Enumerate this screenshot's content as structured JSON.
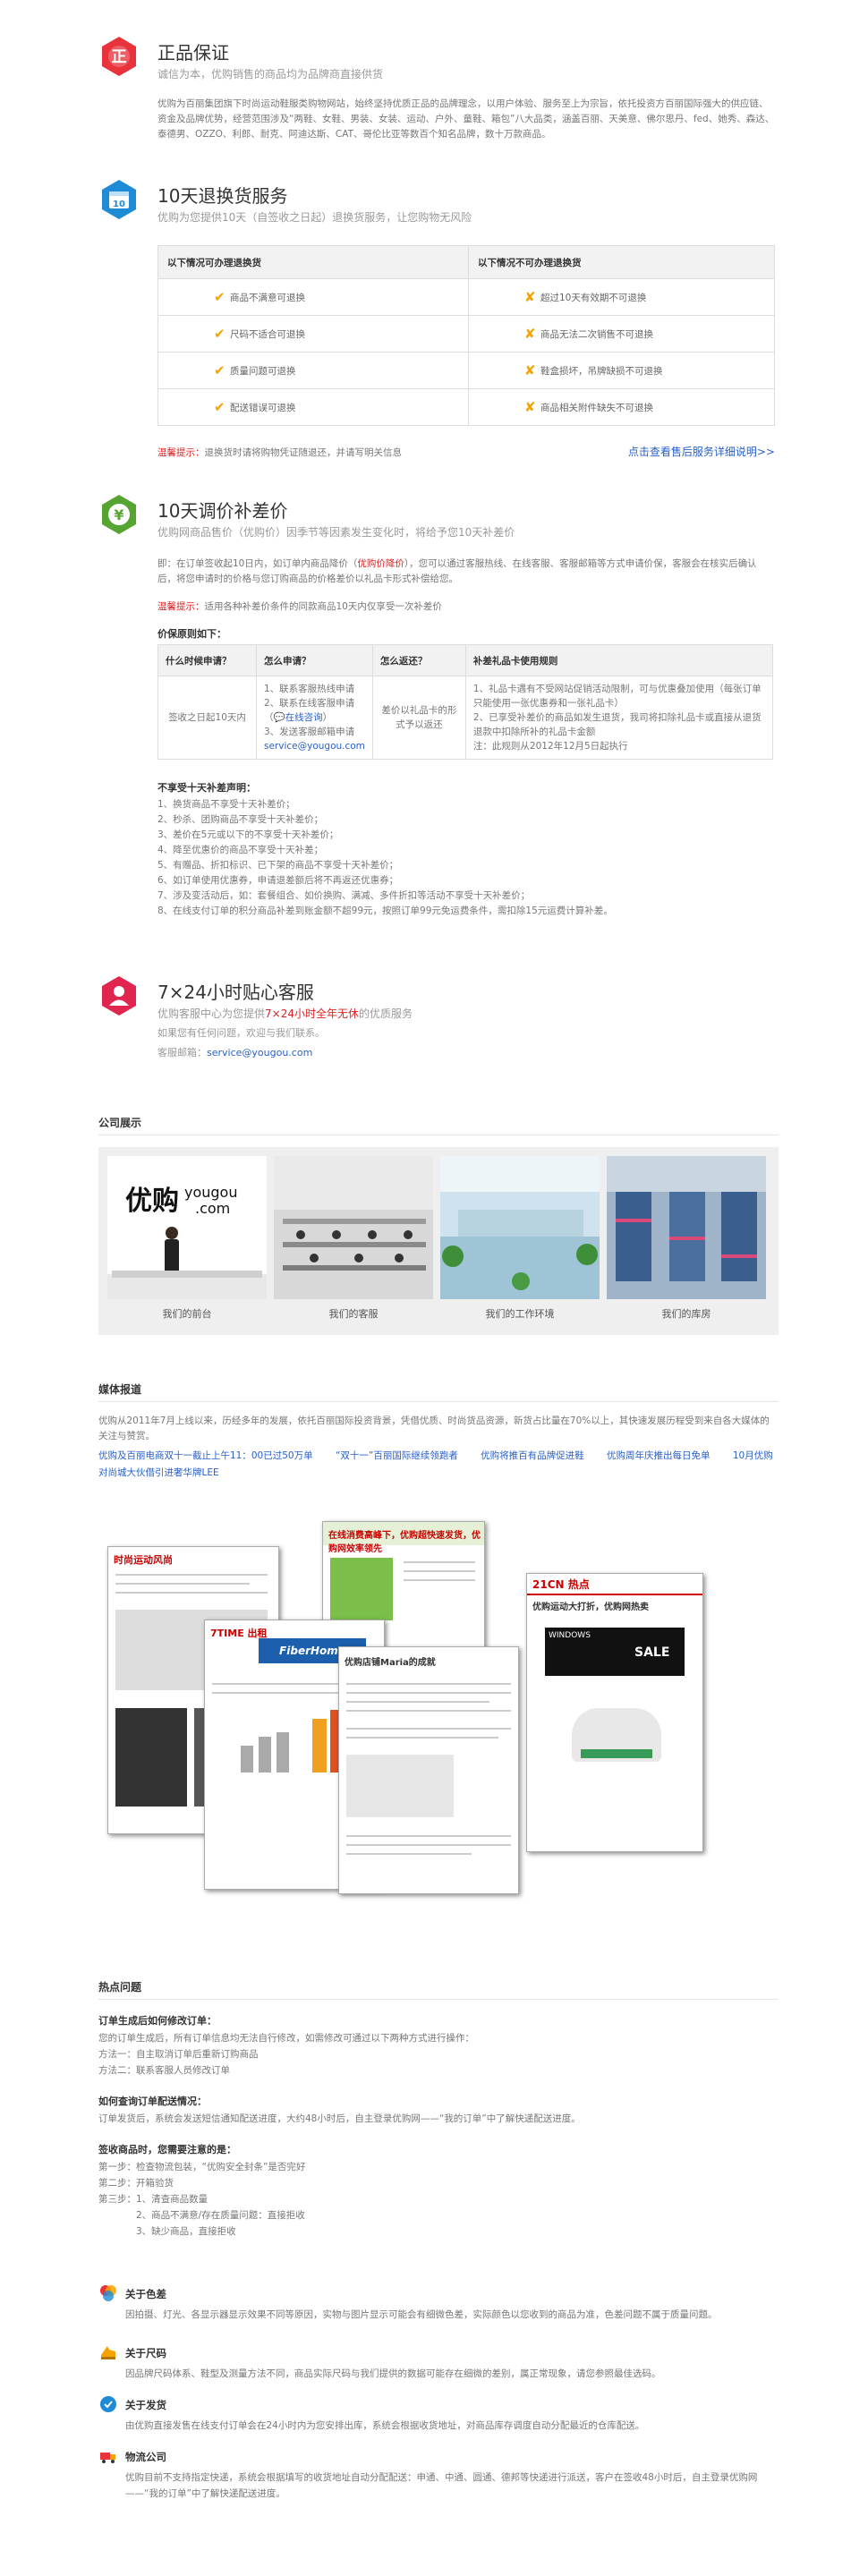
{
  "s1": {
    "icon_char": "正",
    "title": "正品保证",
    "sub": "诚信为本，优购销售的商品均为品牌商直接供货",
    "body": "优购为百丽集团旗下时尚运动鞋服类购物网站，始终坚持优质正品的品牌理念，以用户体验、服务至上为宗旨，依托投资方百丽国际强大的供应链、资金及品牌优势，经营范围涉及“两鞋、女鞋、男装、女装、运动、户外、童鞋、箱包”八大品类，涵盖百丽、天美意、佛尔思丹、fed、她秀、森达、泰德男、OZZO、利郎、耐克、阿迪达斯、CAT、哥伦比亚等数百个知名品牌，数十万款商品。"
  },
  "s2": {
    "title": "10天退换货服务",
    "sub": "优购为您提供10天（自签收之日起）退换货服务，让您购物无风险",
    "col1": "以下情况可办理退换货",
    "col2": "以下情况不可办理退换货",
    "rows": [
      {
        "ok": "商品不满意可退换",
        "no": "超过10天有效期不可退换"
      },
      {
        "ok": "尺码不适合可退换",
        "no": "商品无法二次销售不可退换"
      },
      {
        "ok": "质量问题可退换",
        "no": "鞋盒损坏，吊牌缺损不可退换"
      },
      {
        "ok": "配送错误可退换",
        "no": "商品相关附件缺失不可退换"
      }
    ],
    "check": "✔",
    "cross": "✘",
    "tip_label": "温馨提示：",
    "tip_text": "退换货时请将购物凭证随退还，并请写明关信息",
    "more_link": "点击查看售后服务详细说明>>"
  },
  "s3": {
    "title": "10天调价补差价",
    "sub": "优购网商品售价（优购价）因季节等因素发生变化时，将给予您10天补差价",
    "body_1": "即：在订单签收起10日内，如订单内商品降价（",
    "body_red": "优购价降价",
    "body_2": "），您可以通过客服热线、在线客服、客服邮箱等方式申请价保，客服会在核实后确认后，将您申请时的价格与您订购商品的价格差价以礼品卡形式补偿给您。",
    "tip_label": "温馨提示：",
    "tip_text": "适用各种补差价条件的同款商品10天内仅享受一次补差价",
    "rule_title": "价保原则如下：",
    "th": [
      "什么时候申请？",
      "怎么申请？",
      "怎么返还？",
      "补差礼品卡使用规则"
    ],
    "td_when": "签收之日起10天内",
    "td_how": [
      "1、联系客服热线申请",
      "2、联系在线客服申请",
      "（",
      "在线咨询",
      "）",
      "3、发送客服邮箱申请",
      "service@yougou.com"
    ],
    "td_back": "差价以礼品卡的形式予以返还",
    "td_rule": [
      "1、礼品卡遇有不受网站促销活动限制，可与优惠叠加使用（每张订单只能使用一张优惠券和一张礼品卡）",
      "2、已享受补差价的商品如发生退货，我司将扣除礼品卡或直接从退货退款中扣除所补的礼品卡金额",
      "注：此规则从2012年12月5日起执行"
    ],
    "excl_title": "不享受十天补差声明：",
    "excl": [
      "1、换货商品不享受十天补差价；",
      "2、秒杀、团购商品不享受十天补差价；",
      "3、差价在5元或以下的不享受十天补差价；",
      "4、降至优惠价的商品不享受十天补差；",
      "5、有赠品、折扣标识、已下架的商品不享受十天补差价；",
      "6、如订单使用优惠券，申请退差额后将不再返还优惠券；",
      "7、涉及变活动后，如：套餐组合、如价换购、满减、多件折扣等活动不享受十天补差价；",
      "8、在线支付订单的积分商品补差到账金额不超99元，按照订单99元免运费条件，需扣除15元运费计算补差。"
    ]
  },
  "s4": {
    "title": "7×24小时贴心客服",
    "sub_1": "优购客服中心为您提供",
    "sub_red": "7×24小时全年无休",
    "sub_2": "的优质服务",
    "line2": "如果您有任何问题，欢迎与我们联系。",
    "email_label": "客服邮箱：",
    "email": "service@yougou.com"
  },
  "company": {
    "heading": "公司展示",
    "photos": [
      "我们的前台",
      "我们的客服",
      "我们的工作环境",
      "我们的库房"
    ],
    "logo_cn": "优购",
    "logo_en": "yougou",
    "logo_com": ".com"
  },
  "media": {
    "heading": "媒体报道",
    "intro": "优购从2011年7月上线以来，历经多年的发展，依托百丽国际投资背景，凭借优质、时尚货品资源，新货占比量在70%以上，其快速发展历程受到来自各大媒体的关注与赞赏。",
    "links": [
      "优购及百丽电商双十一截止上午11：00已过50万单",
      "“双十一”百丽国际继续领跑者",
      "优购将推百有品牌促进鞋",
      "优购周年庆推出每日免单",
      "10月优购对尚城大伙借引进奢华牌LEE"
    ],
    "papers": [
      "时尚运动风尚",
      "在线消费高峰下，优购超快速发货，优购网效率领先",
      "优购店铺Maria的成就",
      "7TIME 出租",
      "FiberHome",
      "21CN 热点",
      "优购运动大打折，优购网热卖",
      "WINDOWS",
      "SALE"
    ]
  },
  "faq": {
    "heading": "热点问题",
    "q1": "订单生成后如何修改订单：",
    "q1_lines": [
      "您的订单生成后，所有订单信息均无法自行修改，如需修改可通过以下两种方式进行操作：",
      "方法一：自主取消订单后重新订购商品",
      "方法二：联系客服人员修改订单"
    ],
    "q2": "如何查询订单配送情况：",
    "q2_lines": [
      "订单发货后，系统会发送短信通知配送进度，大约48小时后，自主登录优购网——“我的订单”中了解快递配送进度。"
    ],
    "q3": "签收商品时，您需要注意的是：",
    "q3_lines": [
      "第一步：检查物流包装，“优购安全封条”是否完好",
      "第二步：开箱验货",
      "第三步：1、清查商品数量",
      "　　　　2、商品不满意/存在质量问题：直接拒收",
      "　　　　3、缺少商品，直接拒收"
    ]
  },
  "notes": [
    {
      "icon": "color-icon",
      "title": "关于色差",
      "text": "因拍摄、灯光、各显示器显示效果不同等原因，实物与图片显示可能会有细微色差，实际颜色以您收到的商品为准，色差问题不属于质量问题。"
    },
    {
      "icon": "size-icon",
      "title": "关于尺码",
      "text": "因品牌尺码体系、鞋型及测量方法不同，商品实际尺码与我们提供的数据可能存在细微的差别，属正常现象，请您参照最佳选码。"
    },
    {
      "icon": "ship-icon",
      "title": "关于发货",
      "text": "由优购直接发售在线支付订单会在24小时内为您安排出库，系统会根据收货地址，对商品库存调度自动分配最近的仓库配送。"
    },
    {
      "icon": "logistics-icon",
      "title": "物流公司",
      "text": "优购目前不支持指定快递，系统会根据填写的收货地址自动分配配送：申通、中通、圆通、德邦等快递进行派送，客户在签收48小时后，自主登录优购网——“我的订单”中了解快递配送进度。"
    }
  ],
  "colors": {
    "accent_red": "#e8323c",
    "accent_blue": "#1e8bd6",
    "accent_green": "#56a533",
    "accent_pink": "#e0264e",
    "mark_orange": "#f4a300",
    "link_blue": "#2a60c8"
  }
}
